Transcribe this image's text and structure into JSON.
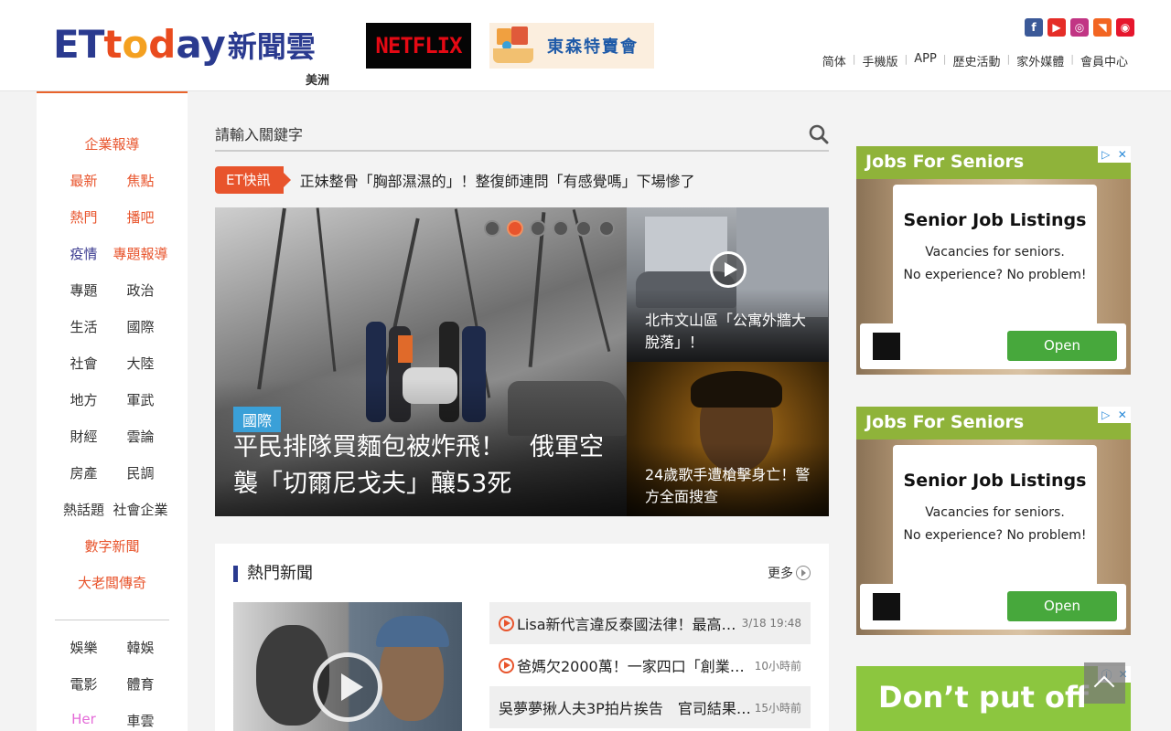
{
  "header": {
    "logo_et": "ET",
    "logo_t": "t",
    "logo_o": "o",
    "logo_d": "d",
    "logo_ay": "ay",
    "logo_cloud": "新聞雲",
    "logo_sub": "美洲",
    "netflix_label": "NETFLIX",
    "tosen_label": "東森特賣會",
    "social": [
      {
        "name": "facebook-icon",
        "glyph": "f",
        "color": "#3b5998"
      },
      {
        "name": "youtube-icon",
        "glyph": "▶",
        "color": "#e52d27"
      },
      {
        "name": "instagram-icon",
        "glyph": "◎",
        "color": "#c13584"
      },
      {
        "name": "rss-icon",
        "glyph": "◥",
        "color": "#f26522"
      },
      {
        "name": "weibo-icon",
        "glyph": "◉",
        "color": "#e6162d"
      }
    ],
    "links": [
      "简体",
      "手機版",
      "APP",
      "歷史活動",
      "家外媒體",
      "會員中心"
    ]
  },
  "leftnav": {
    "rows": [
      [
        "企業報導"
      ],
      [
        "最新",
        "焦點"
      ],
      [
        "熱門",
        "播吧"
      ],
      [
        "疫情",
        "專題報導"
      ],
      [
        "專題",
        "政治"
      ],
      [
        "生活",
        "國際"
      ],
      [
        "社會",
        "大陸"
      ],
      [
        "地方",
        "軍武"
      ],
      [
        "財經",
        "雲論"
      ],
      [
        "房產",
        "民調"
      ],
      [
        "熱話題",
        "社會企業"
      ],
      [
        "數字新聞"
      ],
      [
        "大老闆傳奇"
      ],
      [
        "娛樂",
        "韓娛"
      ],
      [
        "電影",
        "體育"
      ],
      [
        "Her",
        "車雲"
      ]
    ]
  },
  "search": {
    "placeholder": "請輸入關鍵字"
  },
  "flash": {
    "tag": "ET快訊",
    "text": "正妹整骨「胸部濕濕的」！整復師連問「有感覺嗎」下場慘了"
  },
  "hero": {
    "tag": "國際",
    "title": "平民排隊買麵包被炸飛！　俄軍空襲「切爾尼戈夫」釀53死",
    "active_dot": 1,
    "dot_count": 6
  },
  "side": [
    {
      "title": "北市文山區「公寓外牆大脫落」！"
    },
    {
      "title": "24歲歌手遭槍擊身亡！警方全面搜查"
    }
  ],
  "hot": {
    "title": "熱門新聞",
    "more": "更多",
    "items": [
      {
        "text": "Lisa新代言違反泰國法律！最高「…",
        "time": "3/18 19:48",
        "video": true
      },
      {
        "text": "爸媽欠2000萬！一家四口「創業賣…",
        "time": "10小時前",
        "video": true
      },
      {
        "text": "吳夢夢揪人夫3P拍片挨告　官司結果…",
        "time": "15小時前",
        "video": false
      }
    ]
  },
  "ads": [
    {
      "title": "Jobs For Seniors",
      "card_title": "Senior Job Listings",
      "card_line1": "Vacancies for seniors.",
      "card_line2": "No experience? No problem!",
      "button": "Open"
    },
    {
      "title": "Jobs For Seniors",
      "card_title": "Senior Job Listings",
      "card_line1": "Vacancies for seniors.",
      "card_line2": "No experience? No problem!",
      "button": "Open"
    }
  ],
  "ad3": {
    "line1": "Don’t put off"
  },
  "colors": {
    "accent": "#e8542c",
    "brand": "#2a3a8f",
    "tag_blue": "#3aa0d8"
  }
}
